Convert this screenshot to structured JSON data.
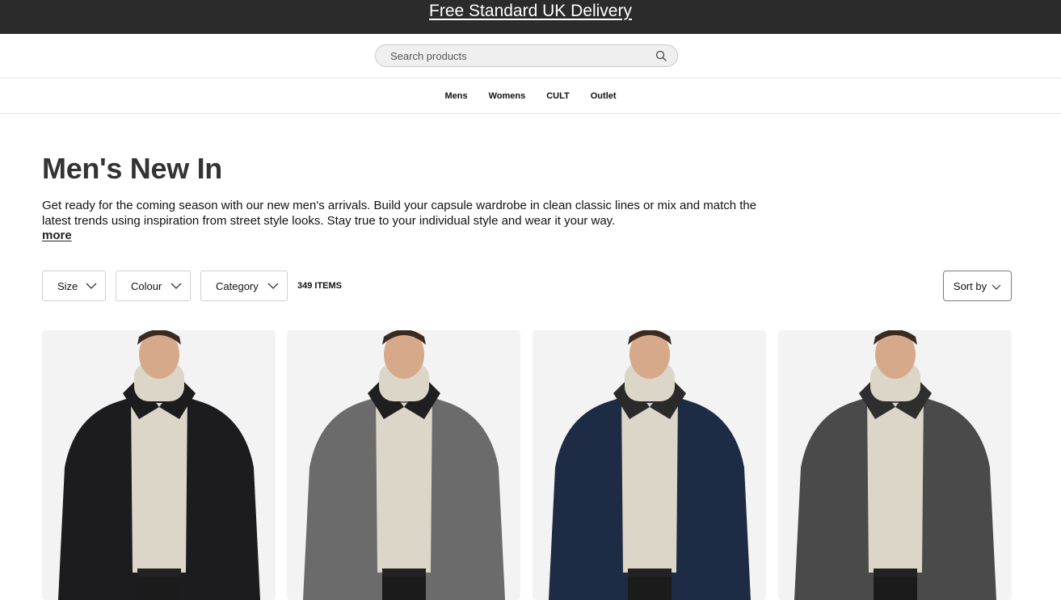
{
  "promo": {
    "text": "Free Standard UK Delivery"
  },
  "search": {
    "placeholder": "Search products",
    "value": ""
  },
  "nav": {
    "items": [
      "Mens",
      "Womens",
      "CULT",
      "Outlet"
    ]
  },
  "page": {
    "title": "Men's New In",
    "description": "Get ready for the coming season with our new men's arrivals. Build your capsule wardrobe in clean classic lines or mix and match the latest trends using inspiration from street style looks. Stay true to your individual style and wear it your way.",
    "more_label": "more"
  },
  "filters": {
    "size_label": "Size",
    "colour_label": "Colour",
    "category_label": "Category",
    "items_count": "349 ITEMS",
    "sort_label": "Sort by"
  },
  "products": [
    {
      "icon": "black-puffer-jacket-image",
      "jacket_color": "#1c1c1e",
      "collar_color": "#1c1c1e"
    },
    {
      "icon": "grey-wool-jacket-image",
      "jacket_color": "#6b6b6b",
      "collar_color": "#1f1f1f"
    },
    {
      "icon": "navy-parka-image",
      "jacket_color": "#1d2b45",
      "collar_color": "#2a2a2a"
    },
    {
      "icon": "charcoal-hooded-jacket-image",
      "jacket_color": "#4a4a4a",
      "collar_color": "#2e2e2e"
    }
  ],
  "colors": {
    "promo_bg": "#2b2b2b",
    "card_bg": "#f3f3f3",
    "title": "#333333"
  }
}
